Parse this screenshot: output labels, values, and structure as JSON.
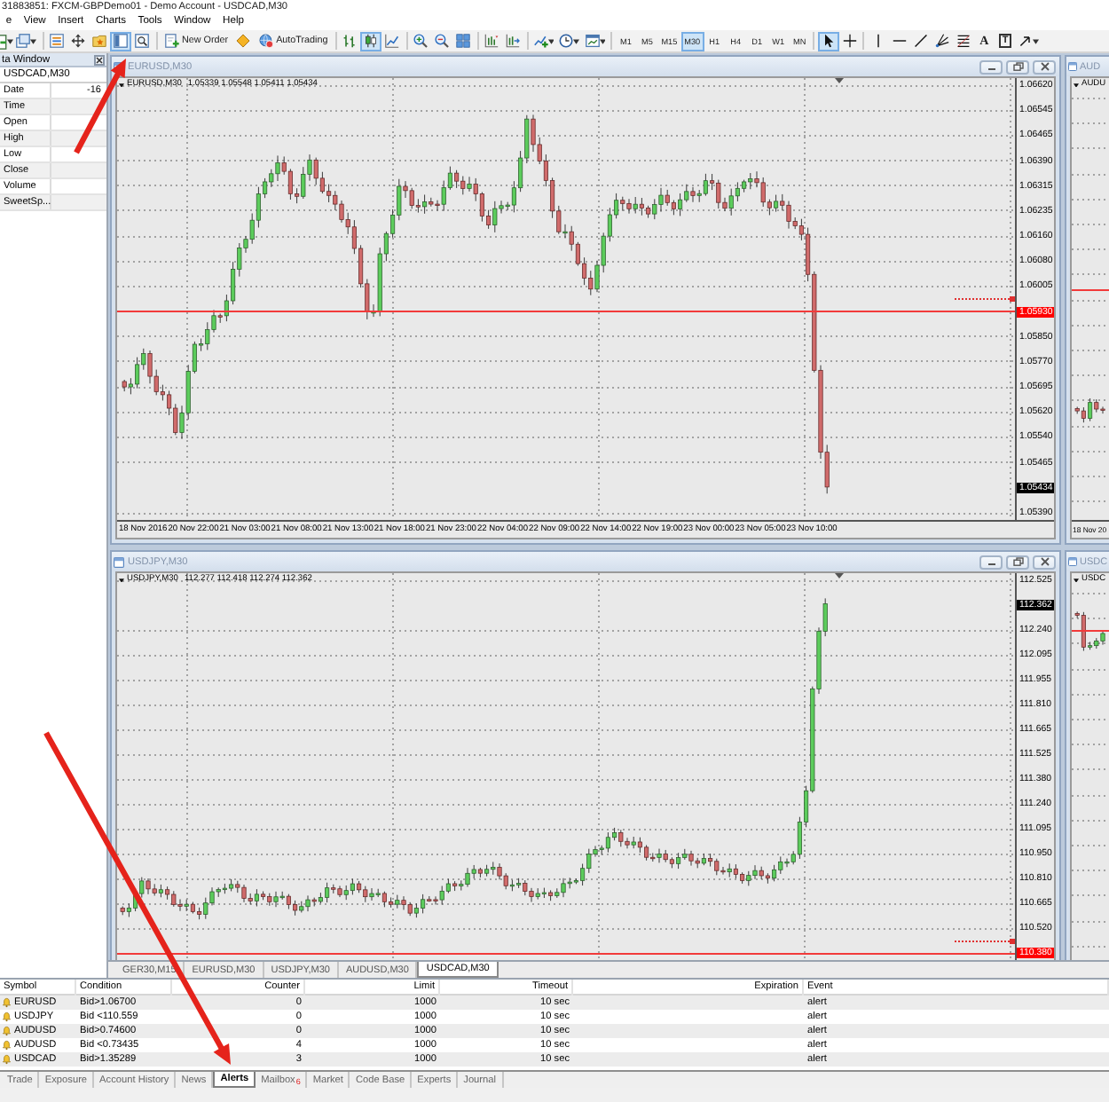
{
  "window": {
    "title": "31883851: FXCM-GBPDemo01 - Demo Account - USDCAD,M30"
  },
  "menu": [
    "e",
    "View",
    "Insert",
    "Charts",
    "Tools",
    "Window",
    "Help"
  ],
  "toolbar": {
    "panel_toggles": [
      {
        "on": false
      },
      {
        "on": false
      },
      {
        "on": false
      },
      {
        "on": true
      },
      {
        "on": false
      }
    ],
    "new_order": "New Order",
    "autotrading": "AutoTrading",
    "chart_types": [
      {
        "selected": false
      },
      {
        "selected": true
      },
      {
        "selected": false
      }
    ],
    "timeframes": [
      {
        "label": "M1",
        "selected": false
      },
      {
        "label": "M5",
        "selected": false
      },
      {
        "label": "M15",
        "selected": false
      },
      {
        "label": "M30",
        "selected": true
      },
      {
        "label": "H1",
        "selected": false
      },
      {
        "label": "H4",
        "selected": false
      },
      {
        "label": "D1",
        "selected": false
      },
      {
        "label": "W1",
        "selected": false
      },
      {
        "label": "MN",
        "selected": false
      }
    ],
    "cursor_modes": [
      {
        "selected": true
      },
      {
        "selected": false
      }
    ],
    "text_tools": [
      {
        "kind": "letter",
        "label": "A"
      },
      {
        "kind": "boxed",
        "label": "T"
      }
    ]
  },
  "data_window": {
    "title": "ta Window",
    "symbol": "USDCAD,M30",
    "rows": [
      {
        "label": "Date",
        "value": "-16"
      },
      {
        "label": "Time"
      },
      {
        "label": "Open"
      },
      {
        "label": "High"
      },
      {
        "label": "Low"
      },
      {
        "label": "Close"
      },
      {
        "label": "Volume"
      },
      {
        "label": "SweetSp..."
      }
    ]
  },
  "charts": [
    {
      "title": "EURUSD,M30",
      "symbol": "EURUSD,M30",
      "ohlc": "1.05339 1.05548 1.05411 1.05434",
      "price_axis": [
        {
          "kind": "tick",
          "text": "1.06620"
        },
        {
          "kind": "tick",
          "text": "1.06545"
        },
        {
          "kind": "tick",
          "text": "1.06465"
        },
        {
          "kind": "tick",
          "text": "1.06390"
        },
        {
          "kind": "tick",
          "text": "1.06315"
        },
        {
          "kind": "tick",
          "text": "1.06235"
        },
        {
          "kind": "tick",
          "text": "1.06160"
        },
        {
          "kind": "tick",
          "text": "1.06080"
        },
        {
          "kind": "tick",
          "text": "1.06005"
        },
        {
          "kind": "alert",
          "text": "1.05930"
        },
        {
          "kind": "tick",
          "text": "1.05850"
        },
        {
          "kind": "tick",
          "text": "1.05770"
        },
        {
          "kind": "tick",
          "text": "1.05695"
        },
        {
          "kind": "tick",
          "text": "1.05620"
        },
        {
          "kind": "tick",
          "text": "1.05540"
        },
        {
          "kind": "tick",
          "text": "1.05465"
        },
        {
          "kind": "bid",
          "text": "1.05434"
        },
        {
          "kind": "tick",
          "text": "1.05390"
        }
      ],
      "time_axis": [
        "18 Nov 2016",
        "20 Nov 22:00",
        "21 Nov 03:00",
        "21 Nov 08:00",
        "21 Nov 13:00",
        "21 Nov 18:00",
        "21 Nov 23:00",
        "22 Nov 04:00",
        "22 Nov 09:00",
        "22 Nov 14:00",
        "22 Nov 19:00",
        "23 Nov 00:00",
        "23 Nov 05:00",
        "23 Nov 10:00"
      ]
    },
    {
      "title": "AUD",
      "symbol": "AUDU",
      "time_axis": [
        "18 Nov 20"
      ]
    },
    {
      "title": "USDJPY,M30",
      "symbol": "USDJPY,M30",
      "ohlc": "112.277 112.418 112.274 112.362",
      "price_axis": [
        {
          "kind": "tick",
          "text": "112.525"
        },
        {
          "kind": "bid",
          "text": "112.362"
        },
        {
          "kind": "tick",
          "text": "112.240"
        },
        {
          "kind": "tick",
          "text": "112.095"
        },
        {
          "kind": "tick",
          "text": "111.955"
        },
        {
          "kind": "tick",
          "text": "111.810"
        },
        {
          "kind": "tick",
          "text": "111.665"
        },
        {
          "kind": "tick",
          "text": "111.525"
        },
        {
          "kind": "tick",
          "text": "111.380"
        },
        {
          "kind": "tick",
          "text": "111.240"
        },
        {
          "kind": "tick",
          "text": "111.095"
        },
        {
          "kind": "tick",
          "text": "110.950"
        },
        {
          "kind": "tick",
          "text": "110.810"
        },
        {
          "kind": "tick",
          "text": "110.665"
        },
        {
          "kind": "tick",
          "text": "110.520"
        },
        {
          "kind": "alert",
          "text": "110.380"
        }
      ]
    },
    {
      "title": "USDC",
      "symbol": "USDC"
    }
  ],
  "chart_tabs": [
    {
      "label": "GER30,M15",
      "selected": false
    },
    {
      "label": "EURUSD,M30",
      "selected": false
    },
    {
      "label": "USDJPY,M30",
      "selected": false
    },
    {
      "label": "AUDUSD,M30",
      "selected": false
    },
    {
      "label": "USDCAD,M30",
      "selected": true
    }
  ],
  "alerts": {
    "columns": [
      "Symbol",
      "Condition",
      "Counter",
      "Limit",
      "Timeout",
      "Expiration",
      "Event"
    ],
    "rows": [
      {
        "symbol": "EURUSD",
        "condition": "Bid>1.06700",
        "counter": "0",
        "limit": "1000",
        "timeout": "10 sec",
        "event": "alert"
      },
      {
        "symbol": "USDJPY",
        "condition": "Bid <110.559",
        "counter": "0",
        "limit": "1000",
        "timeout": "10 sec",
        "event": "alert"
      },
      {
        "symbol": "AUDUSD",
        "condition": "Bid>0.74600",
        "counter": "0",
        "limit": "1000",
        "timeout": "10 sec",
        "event": "alert"
      },
      {
        "symbol": "AUDUSD",
        "condition": "Bid <0.73435",
        "counter": "4",
        "limit": "1000",
        "timeout": "10 sec",
        "event": "alert"
      },
      {
        "symbol": "USDCAD",
        "condition": "Bid>1.35289",
        "counter": "3",
        "limit": "1000",
        "timeout": "10 sec",
        "event": "alert"
      }
    ]
  },
  "terminal_tabs": [
    {
      "label": "Trade",
      "selected": false
    },
    {
      "label": "Exposure",
      "selected": false
    },
    {
      "label": "Account History",
      "selected": false
    },
    {
      "label": "News",
      "selected": false
    },
    {
      "label": "Alerts",
      "selected": true
    },
    {
      "label": "Mailbox",
      "badge": "6",
      "selected": false
    },
    {
      "label": "Market",
      "selected": false
    },
    {
      "label": "Code Base",
      "selected": false
    },
    {
      "label": "Experts",
      "selected": false
    },
    {
      "label": "Journal",
      "selected": false
    }
  ]
}
